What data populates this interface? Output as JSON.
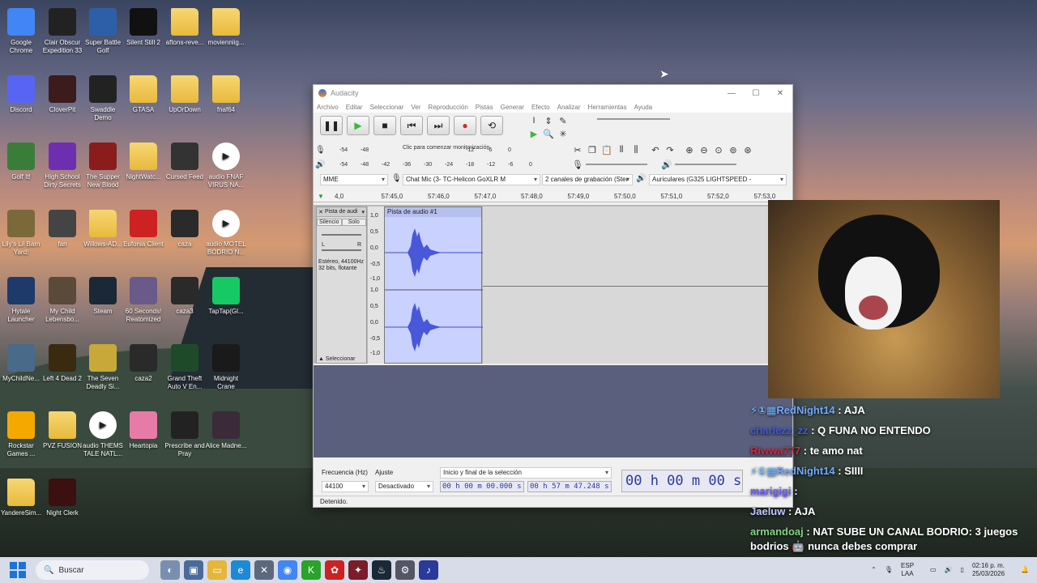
{
  "desktop": {
    "icons": [
      {
        "label": "Google Chrome",
        "icon": "chrome-icon",
        "color": "#4285f4"
      },
      {
        "label": "Clair Obscur Expedition 33",
        "icon": "game-icon",
        "color": "#222"
      },
      {
        "label": "Super Battle Golf",
        "icon": "game-icon",
        "color": "#2d5fa8"
      },
      {
        "label": "Silent Still 2",
        "icon": "game-icon",
        "color": "#111"
      },
      {
        "label": "aftons-reve...",
        "icon": "folder-icon",
        "color": "folder"
      },
      {
        "label": "movienniig...",
        "icon": "folder-icon",
        "color": "folder"
      },
      {
        "label": "Discord",
        "icon": "discord-icon",
        "color": "#5865f2"
      },
      {
        "label": "CloverPit",
        "icon": "game-icon",
        "color": "#3b1b1b"
      },
      {
        "label": "Swaddle Demo",
        "icon": "game-icon",
        "color": "#222"
      },
      {
        "label": "GTASA",
        "icon": "folder-icon",
        "color": "folder"
      },
      {
        "label": "UpOrDown",
        "icon": "folder-icon",
        "color": "folder"
      },
      {
        "label": "fnaf64",
        "icon": "folder-icon",
        "color": "folder"
      },
      {
        "label": "Golf It!",
        "icon": "game-icon",
        "color": "#3a7d3a"
      },
      {
        "label": "High School Dirty Secrets",
        "icon": "game-icon",
        "color": "#6d2fb0"
      },
      {
        "label": "The Supper New Blood",
        "icon": "game-icon",
        "color": "#8a1c1c"
      },
      {
        "label": "NightWatc...",
        "icon": "folder-icon",
        "color": "folder"
      },
      {
        "label": "Cursed Feed",
        "icon": "game-icon",
        "color": "#333"
      },
      {
        "label": "audio FNAF VIRUS NA...",
        "icon": "media-icon",
        "color": "media"
      },
      {
        "label": "Lily's Lil Barn Yard!",
        "icon": "game-icon",
        "color": "#7a6a3a"
      },
      {
        "label": "fan",
        "icon": "game-icon",
        "color": "#444"
      },
      {
        "label": "Willows-AD...",
        "icon": "folder-icon",
        "color": "folder"
      },
      {
        "label": "Eufonia Client",
        "icon": "game-icon",
        "color": "#c22"
      },
      {
        "label": "caza",
        "icon": "game-icon",
        "color": "#2a2a2a"
      },
      {
        "label": "audio MOTEL BODRIO N...",
        "icon": "media-icon",
        "color": "media"
      },
      {
        "label": "Hytale Launcher",
        "icon": "game-icon",
        "color": "#1e3a6a"
      },
      {
        "label": "My Child Lebensbo...",
        "icon": "game-icon",
        "color": "#5a4a3a"
      },
      {
        "label": "Steam",
        "icon": "steam-icon",
        "color": "#1b2838"
      },
      {
        "label": "60 Seconds! Reatomized",
        "icon": "game-icon",
        "color": "#6a5a8a"
      },
      {
        "label": "caza3",
        "icon": "game-icon",
        "color": "#2a2a2a"
      },
      {
        "label": "TapTap(Gl...",
        "icon": "taptap-icon",
        "color": "#17c964"
      },
      {
        "label": "MyChildNe...",
        "icon": "game-icon",
        "color": "#4a6a8a"
      },
      {
        "label": "Left 4 Dead 2",
        "icon": "game-icon",
        "color": "#3a2a10"
      },
      {
        "label": "The Seven Deadly Si...",
        "icon": "game-icon",
        "color": "#c9a83a"
      },
      {
        "label": "caza2",
        "icon": "game-icon",
        "color": "#2a2a2a"
      },
      {
        "label": "Grand Theft Auto V En...",
        "icon": "game-icon",
        "color": "#1f4a2a"
      },
      {
        "label": "Midnight Crane",
        "icon": "game-icon",
        "color": "#1a1a1a"
      },
      {
        "label": "Rockstar Games ...",
        "icon": "rockstar-icon",
        "color": "#f5a800"
      },
      {
        "label": "PVZ FUSION",
        "icon": "folder-icon",
        "color": "folder"
      },
      {
        "label": "audio THEMS TALE NATL...",
        "icon": "media-icon",
        "color": "media"
      },
      {
        "label": "Heartopia",
        "icon": "game-icon",
        "color": "#e87aa8"
      },
      {
        "label": "Prescribe and Pray",
        "icon": "game-icon",
        "color": "#222"
      },
      {
        "label": "Alice Madne...",
        "icon": "game-icon",
        "color": "#3a2a3a"
      },
      {
        "label": "YandereSim...",
        "icon": "folder-icon",
        "color": "folder"
      },
      {
        "label": "Night Clerk",
        "icon": "game-icon",
        "color": "#3a1010"
      }
    ]
  },
  "audacity": {
    "title": "Audacity",
    "menu": [
      "Archivo",
      "Editar",
      "Seleccionar",
      "Ver",
      "Reproducción",
      "Pistas",
      "Generar",
      "Efecto",
      "Analizar",
      "Herramientas",
      "Ayuda"
    ],
    "meter_rec_scale": [
      "-54",
      "-48",
      "",
      "",
      "",
      "",
      "-12",
      "-6",
      "0"
    ],
    "meter_rec_text": "Clic para comenzar monitorización",
    "meter_play_scale": [
      "-54",
      "-48",
      "-42",
      "-36",
      "-30",
      "-24",
      "-18",
      "-12",
      "-6",
      "0"
    ],
    "host": "MME",
    "rec_device": "Chat Mic (3- TC-Helicon GoXLR M",
    "channels": "2 canales de grabación (Ster",
    "play_device": "Auriculares (G325 LIGHTSPEED -",
    "ruler": [
      "4,0",
      "57:45,0",
      "57:46,0",
      "57:47,0",
      "57:48,0",
      "57:49,0",
      "57:50,0",
      "57:51,0",
      "57:52,0",
      "57:53,0"
    ],
    "track": {
      "name": "Pista de audi",
      "clip_name": "Pista de audio #1",
      "mute": "Silencio",
      "solo": "Solo",
      "pan_l": "L",
      "pan_r": "R",
      "info": "Estéreo, 44100Hz 32 bits, flotante",
      "select": "Seleccionar",
      "scale": [
        "1,0",
        "0,5",
        "0,0",
        "-0,5",
        "-1,0",
        "1,0",
        "0,5",
        "0,0",
        "-0,5",
        "-1,0"
      ]
    },
    "selection": {
      "rate_label": "Frecuencia (Hz)",
      "rate_value": "44100",
      "snap_label": "Ajuste",
      "snap_value": "Desactivado",
      "sel_mode": "Inicio y final de la selección",
      "start": "00 h 00 m 00.000 s",
      "end": "00 h 57 m 47.248 s",
      "audio_pos": "00 h 00 m 00 s"
    },
    "status": "Detenido."
  },
  "chat": [
    {
      "badges": "⚡①▦",
      "user": "RedNight14",
      "user_color": "#6fa8ff",
      "text": "AJA"
    },
    {
      "badges": "",
      "user": "charlezz_zz",
      "user_color": "#3b5bd9",
      "text": "Q FUNA NO ENTENDO"
    },
    {
      "badges": "",
      "user": "Riwwa777",
      "user_color": "#d9263b",
      "text": "te amo nat"
    },
    {
      "badges": "⚡①▦",
      "user": "RedNight14",
      "user_color": "#6fa8ff",
      "text": "SIIII"
    },
    {
      "badges": "",
      "user": "marigigi",
      "user_color": "#6a5cff",
      "text": ""
    },
    {
      "badges": "",
      "user": "Jaeluw",
      "user_color": "#c0c6ff",
      "text": "AJA"
    },
    {
      "badges": "",
      "user": "armandoaj",
      "user_color": "#7fd37f",
      "text": "NAT SUBE UN CANAL BODRIO: 3 juegos bodrios 🤖 nunca debes comprar"
    }
  ],
  "taskbar": {
    "search": "Buscar",
    "lang1": "ESP",
    "lang2": "LAA",
    "time": "02:16 p. m.",
    "date": "25/03/2026"
  }
}
